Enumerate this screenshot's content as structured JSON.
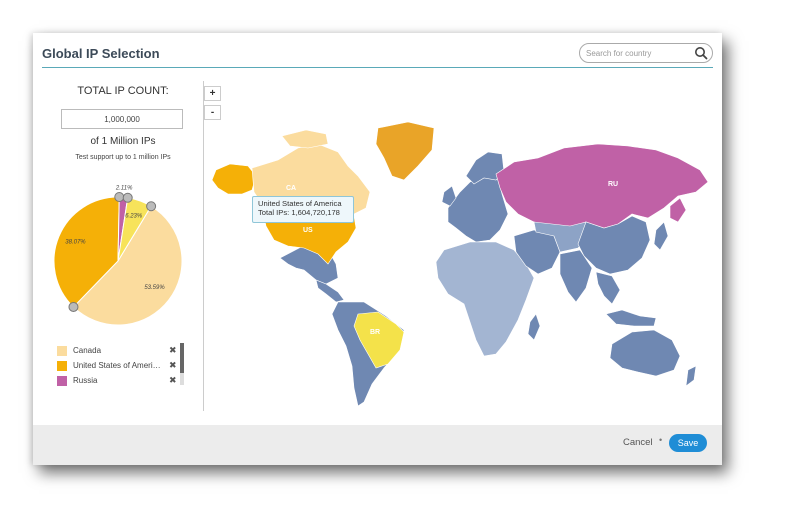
{
  "dialog": {
    "title": "Global IP Selection"
  },
  "search": {
    "placeholder": "Search for country",
    "icon": "search-icon"
  },
  "ip_panel": {
    "count_label": "TOTAL IP COUNT:",
    "count_value": "1,000,000",
    "summary": "of 1 Million IPs",
    "support_note": "Test support up to 1 million IPs"
  },
  "chart_data": {
    "type": "pie",
    "slices": [
      {
        "label": "53.59%",
        "value": 53.59,
        "color": "#fbdc9e"
      },
      {
        "label": "38.07%",
        "value": 38.07,
        "color": "#f5b007"
      },
      {
        "label": "2.11%",
        "value": 2.11,
        "color": "#c061a6"
      },
      {
        "label": "6.23%",
        "value": 6.23,
        "color": "#f7e35a"
      }
    ]
  },
  "legend": {
    "items": [
      {
        "name": "Canada",
        "color": "#fbdc9e"
      },
      {
        "name": "United States of America",
        "color": "#f5b007"
      },
      {
        "name": "Russia",
        "color": "#c061a6"
      }
    ],
    "remove_glyph": "✖"
  },
  "zoom": {
    "in": "+",
    "out": "-"
  },
  "map": {
    "labels": {
      "ca": "CA",
      "us": "US",
      "ru": "RU",
      "br": "BR"
    },
    "colors": {
      "selected_light": "#fbdc9e",
      "selected_orange": "#f5b007",
      "selected_gold": "#e9a428",
      "selected_purple": "#c061a6",
      "selected_yellow": "#f4e24a",
      "base": "#6f88b2",
      "base_light": "#a3b5d2"
    },
    "tooltip": {
      "country": "United States of America",
      "total": "Total IPs: 1,604,720,178"
    }
  },
  "footer": {
    "cancel": "Cancel",
    "separator": "•",
    "save": "Save"
  }
}
